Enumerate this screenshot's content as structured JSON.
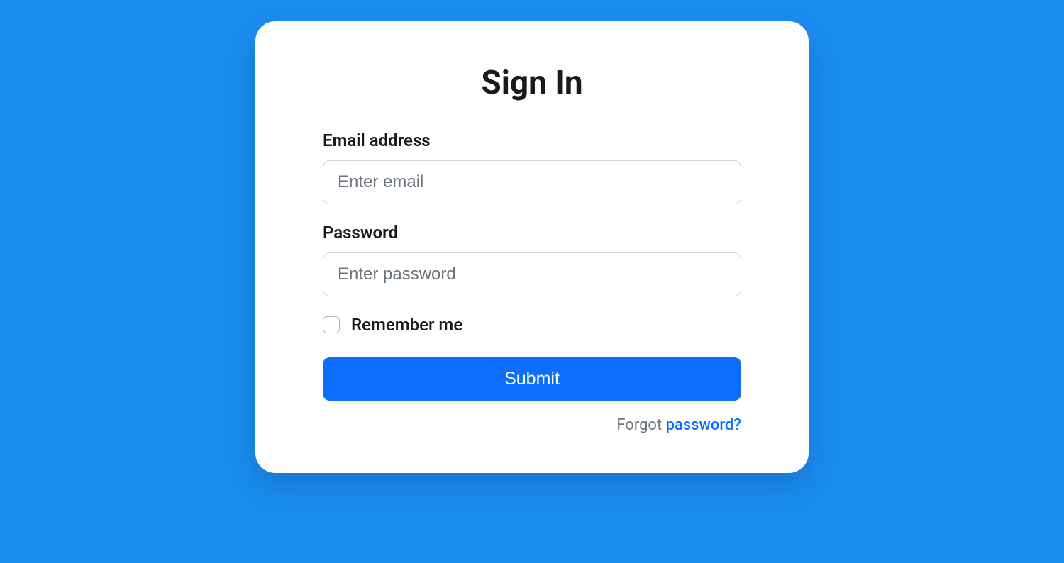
{
  "title": "Sign In",
  "email": {
    "label": "Email address",
    "placeholder": "Enter email",
    "value": ""
  },
  "password": {
    "label": "Password",
    "placeholder": "Enter password",
    "value": ""
  },
  "remember": {
    "label": "Remember me",
    "checked": false
  },
  "submit_label": "Submit",
  "forgot": {
    "text": "Forgot ",
    "link_text": "password?"
  }
}
